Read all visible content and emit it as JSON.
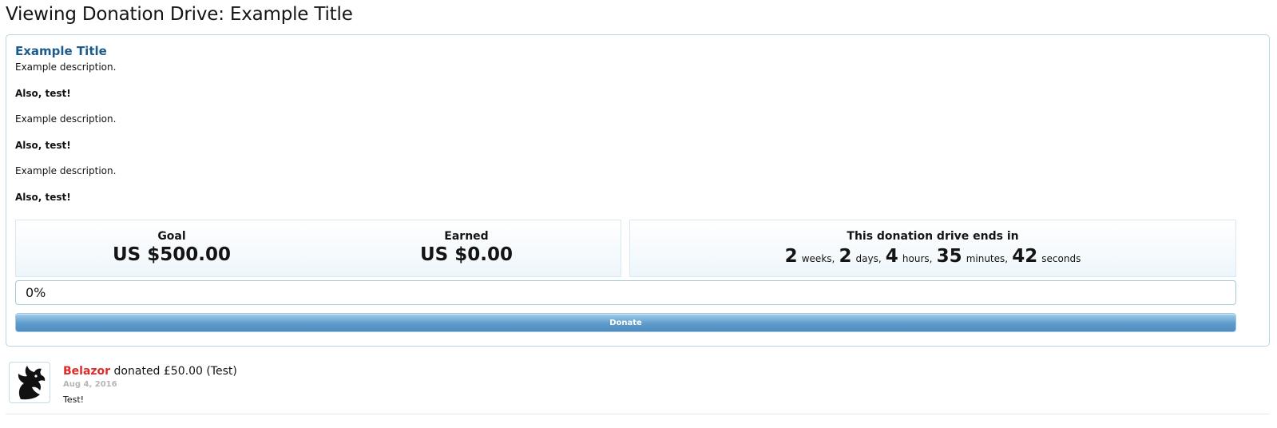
{
  "page": {
    "title": "Viewing Donation Drive: Example Title"
  },
  "drive": {
    "title": "Example Title",
    "description": [
      {
        "text": "Example description.",
        "bold": false
      },
      {
        "text": "Also, test!",
        "bold": true
      },
      {
        "text": "Example description.",
        "bold": false
      },
      {
        "text": "Also, test!",
        "bold": true
      },
      {
        "text": "Example description.",
        "bold": false
      },
      {
        "text": "Also, test!",
        "bold": true
      }
    ],
    "goal": {
      "label": "Goal",
      "value": "US $500.00"
    },
    "earned": {
      "label": "Earned",
      "value": "US $0.00"
    },
    "countdown": {
      "label": "This donation drive ends in",
      "parts": [
        {
          "num": "2",
          "unit": "weeks",
          "sep": ","
        },
        {
          "num": "2",
          "unit": "days",
          "sep": ","
        },
        {
          "num": "4",
          "unit": "hours",
          "sep": ","
        },
        {
          "num": "35",
          "unit": "minutes",
          "sep": ","
        },
        {
          "num": "42",
          "unit": "seconds",
          "sep": ""
        }
      ]
    },
    "progress": {
      "percent": 0,
      "label": "0%"
    },
    "donate_label": "Donate"
  },
  "donations": [
    {
      "name": "Belazor",
      "text": "donated £50.00 (Test)",
      "date": "Aug 4, 2016",
      "message": "Test!",
      "avatar_icon": "dragon-avatar-icon"
    }
  ],
  "colors": {
    "link_title": "#1d5c8a",
    "donor_name": "#e02a2a",
    "button_blue": "#5f9ccc",
    "border": "#b6d7e3"
  }
}
